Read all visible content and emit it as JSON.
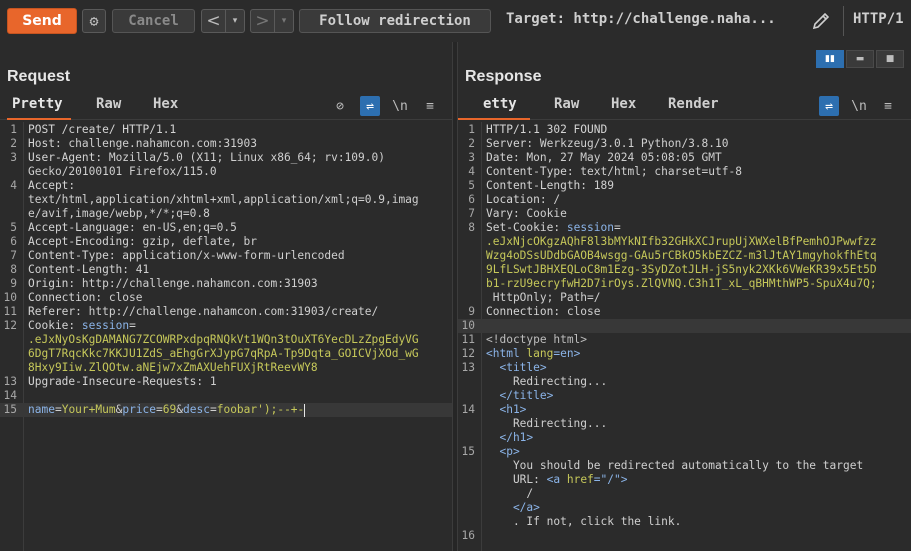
{
  "toolbar": {
    "send_label": "Send",
    "cancel_label": "Cancel",
    "back_glyph": "<",
    "forward_glyph": ">",
    "dropdown_glyph": "▾",
    "follow_label": "Follow redirection",
    "target_label": "Target: http://challenge.naha...",
    "protocol_label": "HTTP/1",
    "icons": [
      "gear-icon",
      "pencil-icon",
      "chevron-left-icon",
      "chevron-right-icon"
    ]
  },
  "request": {
    "title": "Request",
    "tabs": [
      "Pretty",
      "Raw",
      "Hex"
    ],
    "active_tab": "Pretty",
    "tool_icons": {
      "hide": "⊘",
      "wrap": "⇌",
      "newline": "\\n",
      "menu": "≡"
    },
    "lines": [
      {
        "n": "1",
        "parts": [
          [
            "POST /create/ HTTP/1.1",
            "k"
          ]
        ]
      },
      {
        "n": "2",
        "parts": [
          [
            "Host",
            "k"
          ],
          [
            ": challenge.nahamcon.com:31903",
            "v"
          ]
        ]
      },
      {
        "n": "3",
        "parts": [
          [
            "User-Agent",
            "k"
          ],
          [
            ": Mozilla/5.0 (X11; Linux x86_64; rv:109.0)",
            "v"
          ]
        ]
      },
      {
        "n": "",
        "parts": [
          [
            "Gecko/20100101 Firefox/115.0",
            "v"
          ]
        ]
      },
      {
        "n": "4",
        "parts": [
          [
            "Accept",
            "k"
          ],
          [
            ":",
            "v"
          ]
        ]
      },
      {
        "n": "",
        "parts": [
          [
            "text/html,application/xhtml+xml,application/xml;q=0.9,imag",
            "v"
          ]
        ]
      },
      {
        "n": "",
        "parts": [
          [
            "e/avif,image/webp,*/*;q=0.8",
            "v"
          ]
        ]
      },
      {
        "n": "5",
        "parts": [
          [
            "Accept-Language",
            "k"
          ],
          [
            ": en-US,en;q=0.5",
            "v"
          ]
        ]
      },
      {
        "n": "6",
        "parts": [
          [
            "Accept-Encoding",
            "k"
          ],
          [
            ": gzip, deflate, br",
            "v"
          ]
        ]
      },
      {
        "n": "7",
        "parts": [
          [
            "Content-Type",
            "k"
          ],
          [
            ": application/x-www-form-urlencoded",
            "v"
          ]
        ]
      },
      {
        "n": "8",
        "parts": [
          [
            "Content-Length",
            "k"
          ],
          [
            ": 41",
            "v"
          ]
        ]
      },
      {
        "n": "9",
        "parts": [
          [
            "Origin",
            "k"
          ],
          [
            ": http://challenge.nahamcon.com:31903",
            "v"
          ]
        ]
      },
      {
        "n": "10",
        "parts": [
          [
            "Connection",
            "k"
          ],
          [
            ": close",
            "v"
          ]
        ]
      },
      {
        "n": "11",
        "parts": [
          [
            "Referer",
            "k"
          ],
          [
            ": http://challenge.nahamcon.com:31903/create/",
            "v"
          ]
        ]
      },
      {
        "n": "12",
        "parts": [
          [
            "Cookie",
            "k"
          ],
          [
            ": ",
            "v"
          ],
          [
            "session",
            "b"
          ],
          [
            "=",
            "v"
          ]
        ]
      },
      {
        "n": "",
        "parts": [
          [
            ".eJxNyOsKgDAMANG7ZCOWRPxdpqRNQkVt1WQn3tOuXT6YecDLzZpgEdyVG",
            "y"
          ]
        ]
      },
      {
        "n": "",
        "parts": [
          [
            "6DgT7RqcKkc7KKJU1ZdS_aEhgGrXJypG7qRpA-Tp9Dqta_GOICVjXOd_wG",
            "y"
          ]
        ]
      },
      {
        "n": "",
        "parts": [
          [
            "8Hxy9Iiw.ZlQOtw.aNEjw7xZmAXUehFUXjRtReevWY8",
            "y"
          ]
        ]
      },
      {
        "n": "13",
        "parts": [
          [
            "Upgrade-Insecure-Requests",
            "k"
          ],
          [
            ": 1",
            "v"
          ]
        ]
      },
      {
        "n": "14",
        "parts": []
      },
      {
        "n": "15",
        "parts": [
          [
            "name",
            "b"
          ],
          [
            "=",
            "v"
          ],
          [
            "Your+Mum",
            "y"
          ],
          [
            "&",
            "v"
          ],
          [
            "price",
            "b"
          ],
          [
            "=",
            "v"
          ],
          [
            "69",
            "y"
          ],
          [
            "&",
            "v"
          ],
          [
            "desc",
            "b"
          ],
          [
            "=",
            "v"
          ],
          [
            "foobar');--+-",
            "y"
          ]
        ],
        "highlight": true,
        "cursor": true
      }
    ]
  },
  "response": {
    "title": "Response",
    "tabs": [
      "Pretty",
      "Raw",
      "Hex",
      "Render"
    ],
    "active_tab": "Pretty",
    "active_tab_visible": "etty",
    "tool_icons": {
      "wrap": "⇌",
      "newline": "\\n",
      "menu": "≡"
    },
    "lines": [
      {
        "n": "1",
        "parts": [
          [
            "HTTP/1.1 302 FOUND",
            "k"
          ]
        ]
      },
      {
        "n": "2",
        "parts": [
          [
            "Server",
            "k"
          ],
          [
            ": Werkzeug/3.0.1 Python/3.8.10",
            "v"
          ]
        ]
      },
      {
        "n": "3",
        "parts": [
          [
            "Date",
            "k"
          ],
          [
            ": Mon, 27 May 2024 05:08:05 GMT",
            "v"
          ]
        ]
      },
      {
        "n": "4",
        "parts": [
          [
            "Content-Type",
            "k"
          ],
          [
            ": text/html; charset=utf-8",
            "v"
          ]
        ]
      },
      {
        "n": "5",
        "parts": [
          [
            "Content-Length",
            "k"
          ],
          [
            ": 189",
            "v"
          ]
        ]
      },
      {
        "n": "6",
        "parts": [
          [
            "Location",
            "k"
          ],
          [
            ": /",
            "v"
          ]
        ]
      },
      {
        "n": "7",
        "parts": [
          [
            "Vary",
            "k"
          ],
          [
            ": Cookie",
            "v"
          ]
        ]
      },
      {
        "n": "8",
        "parts": [
          [
            "Set-Cookie",
            "k"
          ],
          [
            ": ",
            "v"
          ],
          [
            "session",
            "b"
          ],
          [
            "=",
            "v"
          ]
        ]
      },
      {
        "n": "",
        "parts": [
          [
            ".eJxNjcOKgzAQhF8l3bMYkNIfb32GHkXCJrupUjXWXelBfPemhOJPwwfzz",
            "y"
          ]
        ]
      },
      {
        "n": "",
        "parts": [
          [
            "Wzg4oDSsUDdbGAOB4wsgg-GAu5rCBkO5kbEZCZ-m3lJtAY1mgyhokfhEtq",
            "y"
          ]
        ]
      },
      {
        "n": "",
        "parts": [
          [
            "9LfLSwtJBHXEQLoC8m1Ezg-3SyDZotJLH-jS5nyk2XKk6VWeKR39x5Et5D",
            "y"
          ]
        ]
      },
      {
        "n": "",
        "parts": [
          [
            "b1-rzU9ecryfwH2D7irOys.ZlQVNQ.C3h1T_xL_qBHMthWP5-SpuX4u7Q;",
            "y"
          ]
        ]
      },
      {
        "n": "",
        "parts": [
          [
            " HttpOnly; Path=/",
            "v"
          ]
        ]
      },
      {
        "n": "9",
        "parts": [
          [
            "Connection",
            "k"
          ],
          [
            ": close",
            "v"
          ]
        ]
      },
      {
        "n": "10",
        "parts": [],
        "highlight": true
      },
      {
        "n": "11",
        "parts": [
          [
            "<!doctype html>",
            "g"
          ]
        ]
      },
      {
        "n": "12",
        "parts": [
          [
            "<html ",
            "tag"
          ],
          [
            "lang",
            "ab"
          ],
          [
            "=en>",
            "tag"
          ]
        ]
      },
      {
        "n": "13",
        "parts": [
          [
            "  <title>",
            "tag"
          ]
        ]
      },
      {
        "n": "",
        "parts": [
          [
            "    Redirecting...",
            "v"
          ]
        ]
      },
      {
        "n": "",
        "parts": [
          [
            "  </title>",
            "tag"
          ]
        ]
      },
      {
        "n": "14",
        "parts": [
          [
            "  <h1>",
            "tag"
          ]
        ]
      },
      {
        "n": "",
        "parts": [
          [
            "    Redirecting...",
            "v"
          ]
        ]
      },
      {
        "n": "",
        "parts": [
          [
            "  </h1>",
            "tag"
          ]
        ]
      },
      {
        "n": "15",
        "parts": [
          [
            "  <p>",
            "tag"
          ]
        ]
      },
      {
        "n": "",
        "parts": [
          [
            "    You should be redirected automatically to the target",
            "v"
          ]
        ]
      },
      {
        "n": "",
        "parts": [
          [
            "    URL: ",
            "v"
          ],
          [
            "<a ",
            "tag"
          ],
          [
            "href",
            "ab"
          ],
          [
            "=\"/\">",
            "tag"
          ]
        ]
      },
      {
        "n": "",
        "parts": [
          [
            "      /",
            "v"
          ]
        ]
      },
      {
        "n": "",
        "parts": [
          [
            "    </a>",
            "tag"
          ]
        ]
      },
      {
        "n": "",
        "parts": [
          [
            "    . If not, click the link.",
            "v"
          ]
        ]
      },
      {
        "n": "16",
        "parts": []
      }
    ]
  },
  "layout_buttons": [
    "side-by-side",
    "stacked",
    "single"
  ],
  "colors": {
    "accent": "#e8662b",
    "selected": "#2d6fb0"
  }
}
